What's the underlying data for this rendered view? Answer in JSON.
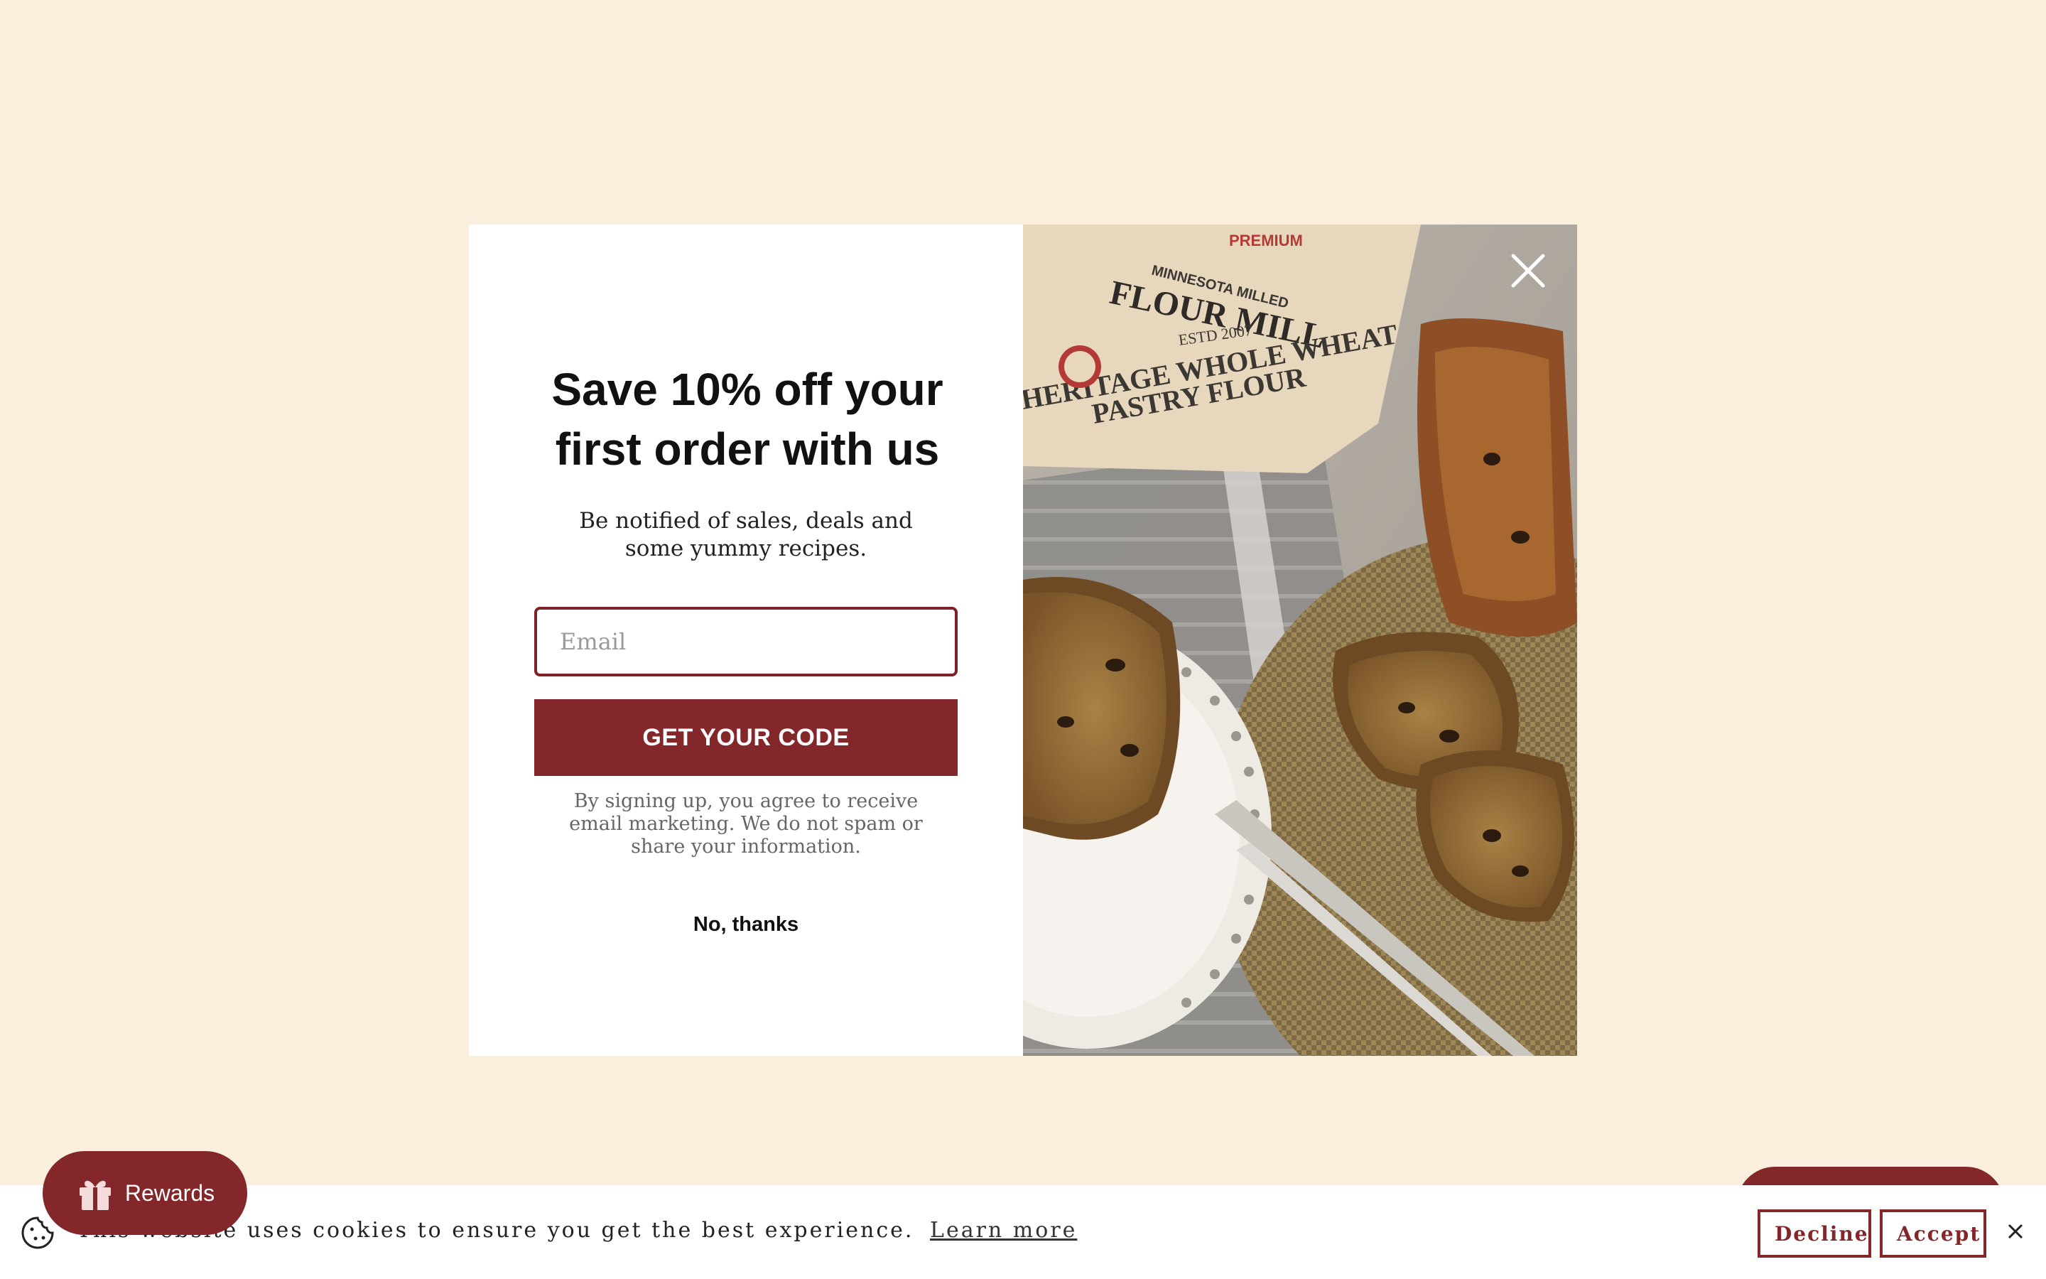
{
  "popup": {
    "headline": "Save 10% off your first order with us",
    "subtext": "Be notified of sales, deals and some yummy recipes.",
    "email_placeholder": "Email",
    "cta_label": "GET YOUR CODE",
    "disclaimer": "By signing up, you agree to receive email marketing. We do not spam or share your information.",
    "decline_label": "No, thanks",
    "image": {
      "bag_text_1": "PREMIUM",
      "bag_text_2": "MINNESOTA MILLED",
      "bag_text_3": "FLOUR MILL",
      "bag_text_4": "ESTD 2007",
      "bag_text_5": "HERITAGE WHOLE WHEAT",
      "bag_text_6": "PASTRY FLOUR"
    }
  },
  "rewards": {
    "label": "Rewards"
  },
  "cookie_bar": {
    "message": "This website uses cookies to ensure you get the best experience.",
    "learn_more": "Learn more",
    "decline": "Decline",
    "accept": "Accept"
  },
  "colors": {
    "brand": "#84272a",
    "background": "#faefdc"
  }
}
